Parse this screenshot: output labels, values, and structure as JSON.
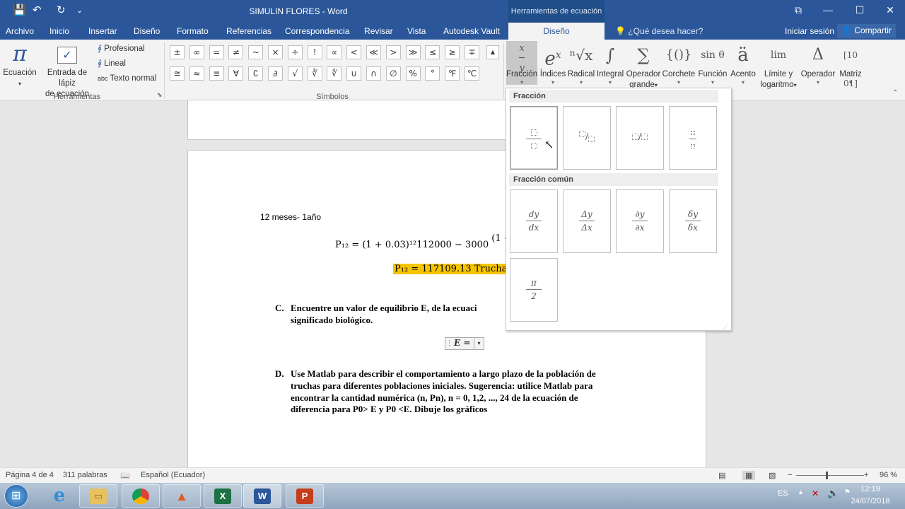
{
  "window": {
    "title": "SIMULIN FLORES - Word",
    "context_title": "Herramientas de ecuación"
  },
  "quick_access": {
    "save": "💾",
    "undo": "↶",
    "redo": "↻",
    "customize": "⌄"
  },
  "window_controls": {
    "restore_ribbon": "⧉",
    "minimize": "—",
    "maximize": "☐",
    "close": "✕"
  },
  "tabs": [
    "Archivo",
    "Inicio",
    "Insertar",
    "Diseño",
    "Formato",
    "Referencias",
    "Correspondencia",
    "Revisar",
    "Vista",
    "Autodesk Vault"
  ],
  "active_context_tab": "Diseño",
  "tell_me": "¿Qué desea hacer?",
  "signin": "Iniciar sesión",
  "share": "Compartir",
  "ribbon": {
    "herramientas": {
      "ecuacion": "Ecuación",
      "lapiz_1": "Entrada de lápiz",
      "lapiz_2": "de ecuación",
      "profesional": "Profesional",
      "lineal": "Lineal",
      "texto_normal": "Texto normal",
      "texto_normal_prefix": "abc",
      "group": "Herramientas"
    },
    "simbolos": {
      "row1": [
        "±",
        "∞",
        "=",
        "≠",
        "~",
        "×",
        "÷",
        "!",
        "∝",
        "<",
        "≪",
        ">",
        "≫",
        "≤",
        "≥",
        "∓"
      ],
      "row2": [
        "≅",
        "≈",
        "≡",
        "∀",
        "∁",
        "∂",
        "√",
        "∛",
        "∜",
        "∪",
        "∩",
        "∅",
        "%",
        "°",
        "℉",
        "℃"
      ],
      "group": "Símbolos"
    },
    "estructuras": [
      {
        "icon": "x/y",
        "label": "Fracción",
        "label2": ""
      },
      {
        "icon": "eˣ",
        "label": "Índices",
        "label2": ""
      },
      {
        "icon": "ⁿ√x",
        "label": "Radical",
        "label2": ""
      },
      {
        "icon": "∫",
        "label": "Integral",
        "label2": ""
      },
      {
        "icon": "∑",
        "label": "Operador",
        "label2": "grande"
      },
      {
        "icon": "{()}",
        "label": "Corchete",
        "label2": ""
      },
      {
        "icon": "sin θ",
        "label": "Función",
        "label2": ""
      },
      {
        "icon": "ä",
        "label": "Acento",
        "label2": ""
      },
      {
        "icon": "lim",
        "label": "Límite y",
        "label2": "logaritmo"
      },
      {
        "icon": "Δ",
        "label": "Operador",
        "label2": ""
      },
      {
        "icon": "[10 01]",
        "label": "Matriz",
        "label2": ""
      }
    ]
  },
  "gallery": {
    "section1": "Fracción",
    "section2": "Fracción común",
    "common": [
      {
        "num": "dy",
        "den": "dx"
      },
      {
        "num": "Δy",
        "den": "Δx"
      },
      {
        "num": "∂y",
        "den": "∂x"
      },
      {
        "num": "δy",
        "den": "δx"
      },
      {
        "num": "π",
        "den": "2"
      }
    ]
  },
  "document": {
    "line1": "12 meses- 1año",
    "eq1": "P₁₂ = (1 + 0.03)¹²112000 − 3000",
    "eq1_tail": "(1 +",
    "eq2": "P₁₂ = 117109.13 Truchas",
    "c_label": "C.",
    "c_text1": "Encuentre un valor de equilibrio E, de la ecuaci",
    "c_text2": "significado biológico.",
    "eq3": "E =",
    "d_label": "D.",
    "d_lines": [
      "Use Matlab para describir el comportamiento a largo plazo de la población de",
      "truchas para diferentes poblaciones iniciales. Sugerencia: utilice Matlab para",
      "encontrar la cantidad numérica (n, Pn), n = 0, 1,2, ..., 24 de la ecuación de",
      "diferencia para P0> E y P0 <E. Dibuje los gráficos"
    ]
  },
  "status": {
    "page": "Página 4 de 4",
    "words": "311 palabras",
    "lang": "Español (Ecuador)",
    "zoom": "96 %"
  },
  "taskbar": {
    "lang": "ES",
    "time": "12:19",
    "date": "24/07/2018"
  },
  "colors": {
    "word_blue": "#2b579a",
    "highlight": "#f5c400"
  }
}
